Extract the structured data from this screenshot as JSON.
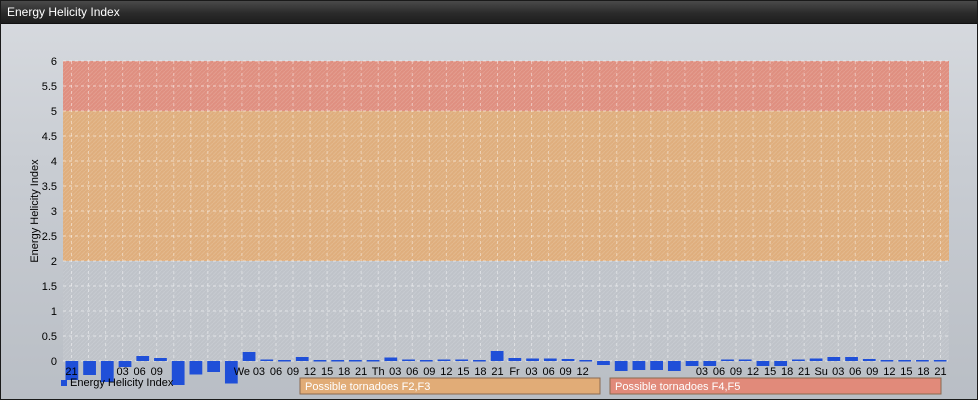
{
  "window": {
    "title": "Energy Helicity Index"
  },
  "chart_data": {
    "type": "bar",
    "title": "",
    "xlabel": "",
    "ylabel": "Energy Helicity Index",
    "ylim": [
      -0.5,
      6
    ],
    "yticks": [
      "0",
      "0.5",
      "1",
      "1.5",
      "2",
      "2.5",
      "3",
      "3.5",
      "4",
      "4.5",
      "5",
      "5.5",
      "6"
    ],
    "grid": true,
    "legend": {
      "placement": "bottom-left",
      "label": "Energy Helicity Index"
    },
    "bands": [
      {
        "from": 2,
        "to": 5,
        "color": "#e8a868",
        "label": "Possible tornadoes F2,F3"
      },
      {
        "from": 5,
        "to": 6,
        "color": "#e8806c",
        "label": "Possible tornadoes F4,F5"
      }
    ],
    "series": [
      {
        "name": "Energy Helicity Index",
        "color": "#1f4fd8",
        "values": [
          -0.38,
          -0.28,
          -0.42,
          -0.12,
          0.1,
          0.06,
          -0.48,
          -0.27,
          -0.22,
          -0.45,
          0.18,
          0.03,
          0.02,
          0.08,
          0.02,
          0.02,
          0.02,
          0.02,
          0.07,
          0.03,
          0.02,
          0.03,
          0.03,
          0.02,
          0.2,
          0.06,
          0.05,
          0.05,
          0.04,
          0.02,
          -0.08,
          -0.2,
          -0.18,
          -0.18,
          -0.2,
          -0.1,
          -0.1,
          0.03,
          0.03,
          -0.1,
          -0.1,
          0.03,
          0.05,
          0.08,
          0.08,
          0.04,
          0.02,
          0.02,
          0.02,
          0.02
        ]
      }
    ],
    "x_labels": [
      "21",
      "",
      "",
      "03",
      "06",
      "09",
      "",
      "",
      "",
      "",
      "We",
      "03",
      "06",
      "09",
      "12",
      "15",
      "18",
      "21",
      "Th",
      "03",
      "06",
      "09",
      "12",
      "15",
      "18",
      "21",
      "Fr",
      "03",
      "06",
      "09",
      "12",
      "",
      "",
      "",
      "",
      "",
      "",
      "03",
      "06",
      "09",
      "12",
      "15",
      "18",
      "21",
      "Su",
      "03",
      "06",
      "09",
      "12",
      "15",
      "18",
      "21"
    ]
  }
}
